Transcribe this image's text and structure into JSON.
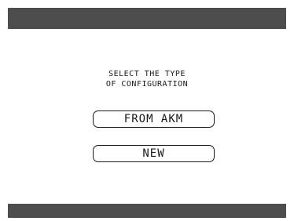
{
  "screen": {
    "prompt_line_1": "SELECT THE TYPE",
    "prompt_line_2": "OF CONFIGURATION"
  },
  "buttons": {
    "from_akm_label": "FROM AKM",
    "new_label": "NEW"
  },
  "colors": {
    "bar": "#4d4d4d",
    "background": "#ffffff",
    "text": "#1a1a1a"
  }
}
